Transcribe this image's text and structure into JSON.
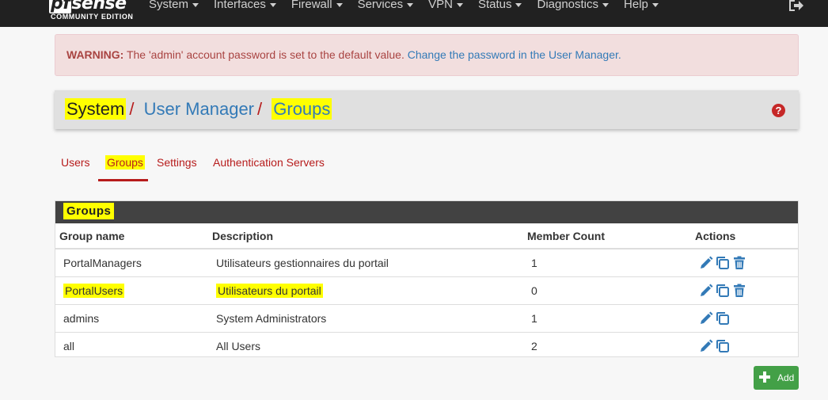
{
  "navbar": {
    "logo_main": "pfsense",
    "logo_pf": "pf",
    "logo_rest": "sense",
    "logo_sub": "COMMUNITY EDITION",
    "menu": [
      "System",
      "Interfaces",
      "Firewall",
      "Services",
      "VPN",
      "Status",
      "Diagnostics",
      "Help"
    ],
    "logout_icon": "sign-out-icon"
  },
  "alert": {
    "prefix": "WARNING:",
    "text": " The 'admin' account password is set to the default value. ",
    "link": "Change the password in the User Manager."
  },
  "breadcrumb": {
    "items": [
      "System",
      "User Manager",
      "Groups"
    ],
    "separator": "/",
    "help_icon": "question-circle-icon"
  },
  "tabs": {
    "items": [
      "Users",
      "Groups",
      "Settings",
      "Authentication Servers"
    ],
    "active": "Groups"
  },
  "panel": {
    "title": "Groups",
    "columns": [
      "Group name",
      "Description",
      "Member Count",
      "Actions"
    ],
    "rows": [
      {
        "name": "PortalManagers",
        "description": "Utilisateurs gestionnaires du portail",
        "count": "1",
        "deletable": true
      },
      {
        "name": "PortalUsers",
        "description": "Utilisateurs du portail",
        "count": "0",
        "deletable": true,
        "highlight": true
      },
      {
        "name": "admins",
        "description": "System Administrators",
        "count": "1",
        "deletable": false
      },
      {
        "name": "all",
        "description": "All Users",
        "count": "2",
        "deletable": false
      }
    ]
  },
  "add_button": {
    "label": "Add",
    "icon": "plus-icon"
  },
  "colors": {
    "navbar": "#212121",
    "accent_red": "#b71c1c",
    "link_blue": "#337ab7",
    "highlight": "#ffff00",
    "add_green": "#43a047"
  }
}
